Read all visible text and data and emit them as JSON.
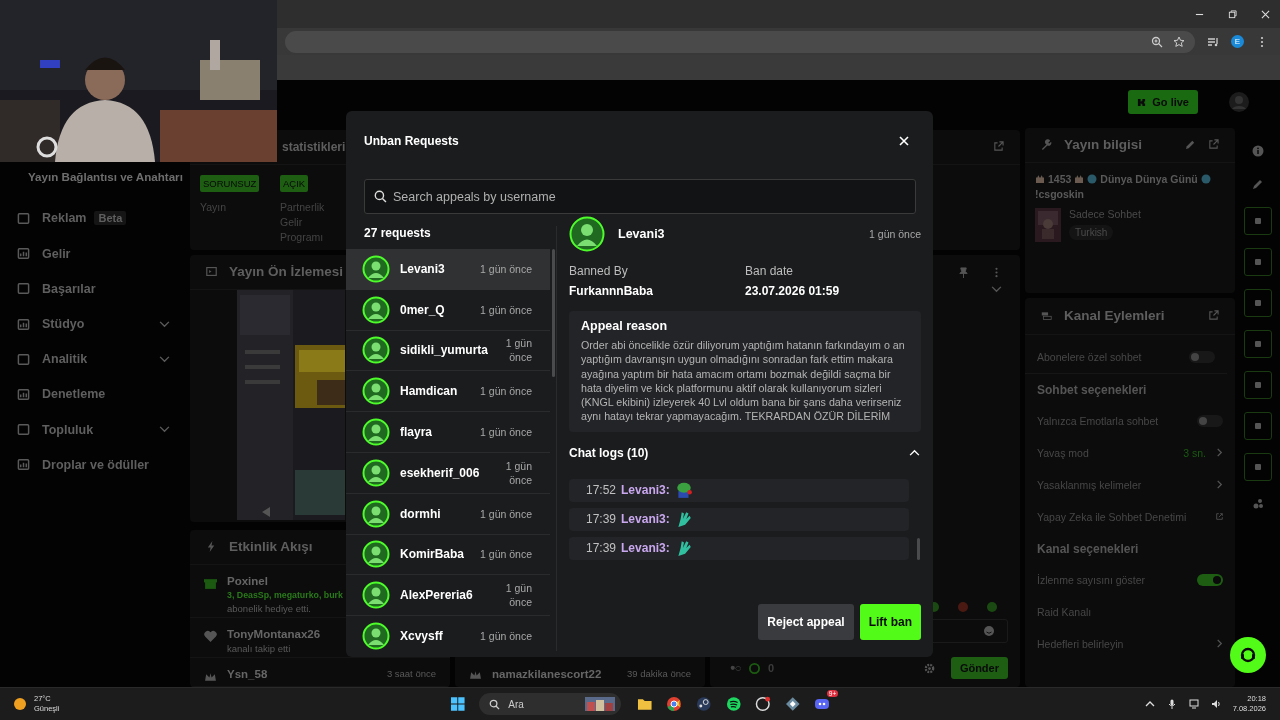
{
  "browser": {
    "profile": "E"
  },
  "header": {
    "go_live": "Go live"
  },
  "sidebar": {
    "heading": "Yayın Bağlantısı ve Anahtarı",
    "items": [
      {
        "kind": "link",
        "label": "Reklam",
        "badge": "Beta"
      },
      {
        "kind": "link",
        "label": "Gelir"
      },
      {
        "kind": "link",
        "label": "Başarılar"
      },
      {
        "kind": "group",
        "label": "Stüdyo"
      },
      {
        "kind": "group",
        "label": "Analitik"
      },
      {
        "kind": "link",
        "label": "Denetleme"
      },
      {
        "kind": "group",
        "label": "Topluluk"
      },
      {
        "kind": "link",
        "label": "Droplar ve ödüller"
      }
    ]
  },
  "stats_panel": {
    "title": "statistikleri",
    "statuses": [
      {
        "badge": "SORUNSUZ",
        "caption": "Yayın"
      },
      {
        "badge": "AÇIK",
        "caption": "Partnerlik Gelir Programı"
      }
    ]
  },
  "preview_panel": {
    "title": "Yayın Ön İzlemesi"
  },
  "activity_panel": {
    "title": "Etkinlik Akışı",
    "events": [
      {
        "kind": "gift",
        "user": "Poxinel",
        "detail": "3, DeasSp, megaturko, burk",
        "note": "abonelik hediye etti."
      },
      {
        "kind": "follow",
        "user": "TonyMontanax26",
        "note": "kanalı takip etti"
      },
      {
        "kind": "sub",
        "user": "Ysn_58",
        "time": "3 saat önce"
      }
    ]
  },
  "chat_panel": {
    "message": {
      "user": "namazkilanescort22",
      "time": "39 dakika önce"
    },
    "count": "0",
    "send": "Gönder"
  },
  "stream_info": {
    "title": "Yayın bilgisi",
    "title_parts": [
      "1453",
      "Dünya Dünya Günü",
      "!csgoskin"
    ],
    "category": "Sadece Sohbet",
    "tag": "Turkish"
  },
  "channel_actions": {
    "title": "Kanal Eylemleri",
    "rows": [
      {
        "kind": "toggle",
        "label": "Abonelere özel sohbet",
        "on": false
      },
      {
        "kind": "heading",
        "label": "Sohbet seçenekleri"
      },
      {
        "kind": "toggle",
        "label": "Yalnızca Emotlarla sohbet",
        "on": false
      },
      {
        "kind": "link",
        "label": "Yavaş mod",
        "value": "3 sn."
      },
      {
        "kind": "link",
        "label": "Yasaklanmış kelimeler"
      },
      {
        "kind": "external",
        "label": "Yapay Zeka ile Sohbet Denetimi"
      },
      {
        "kind": "heading",
        "label": "Kanal seçenekleri"
      },
      {
        "kind": "toggle",
        "label": "İzlenme sayısını göster",
        "on": true
      },
      {
        "kind": "plain",
        "label": "Raid Kanalı"
      },
      {
        "kind": "link",
        "label": "Hedefleri belirleyin"
      }
    ]
  },
  "modal": {
    "title": "Unban Requests",
    "search_placeholder": "Search appeals by username",
    "count": "27 requests",
    "requests": [
      {
        "user": "Levani3",
        "time": "1 gün önce",
        "selected": true
      },
      {
        "user": "0mer_Q",
        "time": "1 gün önce",
        "selected": false
      },
      {
        "user": "sidikli_yumurta",
        "time": "1 gün önce",
        "selected": false
      },
      {
        "user": "Hamdican",
        "time": "1 gün önce",
        "selected": false
      },
      {
        "user": "flayra",
        "time": "1 gün önce",
        "selected": false
      },
      {
        "user": "esekherif_006",
        "time": "1 gün önce",
        "selected": false
      },
      {
        "user": "dormhi",
        "time": "1 gün önce",
        "selected": false
      },
      {
        "user": "KomirBaba",
        "time": "1 gün önce",
        "selected": false
      },
      {
        "user": "AlexPereria6",
        "time": "1 gün önce",
        "selected": false
      },
      {
        "user": "Xcvysff",
        "time": "1 gün önce",
        "selected": false
      }
    ],
    "detail": {
      "user": "Levani3",
      "time": "1 gün önce",
      "banned_by_label": "Banned By",
      "banned_by": "FurkannnBaba",
      "ban_date_label": "Ban date",
      "ban_date": "23.07.2026 01:59",
      "reason_title": "Appeal reason",
      "reason": "Order abi öncelikle özür diliyorum yaptığım hatanın farkındayım o an yaptığım davranışın uygun olmadığını sonradan fark ettim makara ayağına yaptım bir hata amacım ortamı bozmak değildi saçma bir hata diyelim ve kick platformunu aktif olarak kullanıyorum sizleri (KNGL ekibini) izleyerek 40 Lvl oldum bana bir şans daha verirseniz aynı hatayı tekrar yapmayacağım. TEKRARDAN ÖZÜR DİLERİM",
      "logs_title": "Chat logs (10)",
      "logs_expanded": true,
      "logs": [
        {
          "time": "17:52",
          "user": "Levani3:"
        },
        {
          "time": "17:39",
          "user": "Levani3:"
        },
        {
          "time": "17:39",
          "user": "Levani3:"
        }
      ],
      "reject": "Reject appeal",
      "lift": "Lift ban"
    }
  },
  "taskbar": {
    "temperature": "27°C",
    "weather": "Güneşli",
    "search": "Ara",
    "discord_badge": "9+",
    "time": "20:18",
    "date": "7.08.2026"
  }
}
